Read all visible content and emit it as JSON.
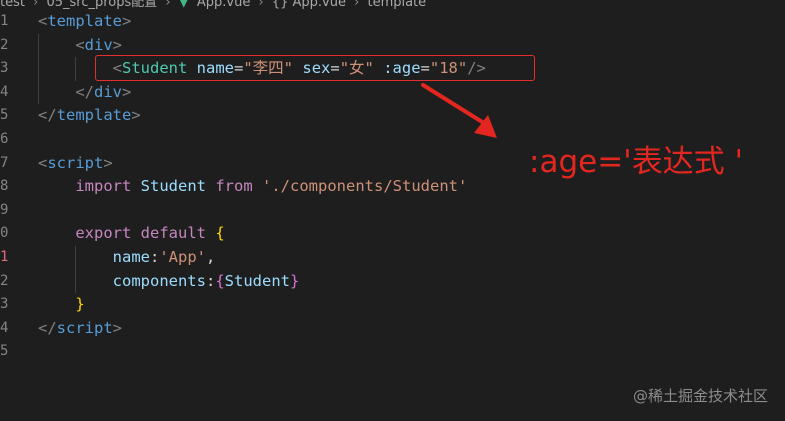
{
  "breadcrumb": {
    "items": [
      "test",
      "05_src_props配置",
      "App.vue",
      "{} App.vue",
      "template"
    ],
    "vue_icon": "vue-file-icon"
  },
  "gutter": {
    "numbers": [
      "1",
      "2",
      "3",
      "4",
      "5",
      "6",
      "7",
      "8",
      "9",
      "0",
      "1",
      "2",
      "3",
      "4",
      "5"
    ]
  },
  "code": {
    "l1_open": "<",
    "l1_tag": "template",
    "l1_close": ">",
    "l2_open": "<",
    "l2_tag": "div",
    "l2_close": ">",
    "l3_open": "<",
    "l3_comp": "Student",
    "l3_attr1": "name",
    "l3_eq1": "=",
    "l3_val1": "\"李四\"",
    "l3_attr2": "sex",
    "l3_eq2": "=",
    "l3_val2": "\"女\"",
    "l3_attr3": ":age",
    "l3_eq3": "=",
    "l3_val3": "\"18\"",
    "l3_close": "/>",
    "l4_open": "</",
    "l4_tag": "div",
    "l4_close": ">",
    "l5_open": "</",
    "l5_tag": "template",
    "l5_close": ">",
    "l7_open": "<",
    "l7_tag": "script",
    "l7_close": ">",
    "l8_kw": "import",
    "l8_ident": "Student",
    "l8_from": "from",
    "l8_str": "'./components/Student'",
    "l10_kw1": "export",
    "l10_kw2": "default",
    "l10_brace": "{",
    "l11_key": "name",
    "l11_colon": ":",
    "l11_str": "'App'",
    "l11_comma": ",",
    "l12_key": "components",
    "l12_colon": ":",
    "l12_brace_open": "{",
    "l12_ident": "Student",
    "l12_brace_close": "}",
    "l13_brace": "}",
    "l14_open": "</",
    "l14_tag": "script",
    "l14_close": ">"
  },
  "annotation": {
    "text": ":age='表达式 '",
    "color": "#e3261f"
  },
  "watermark": {
    "text": "@稀土掘金技术社区"
  },
  "colors": {
    "background": "#1e1e1e",
    "highlight_box": "#e0302f",
    "arrow": "#e3261f"
  }
}
